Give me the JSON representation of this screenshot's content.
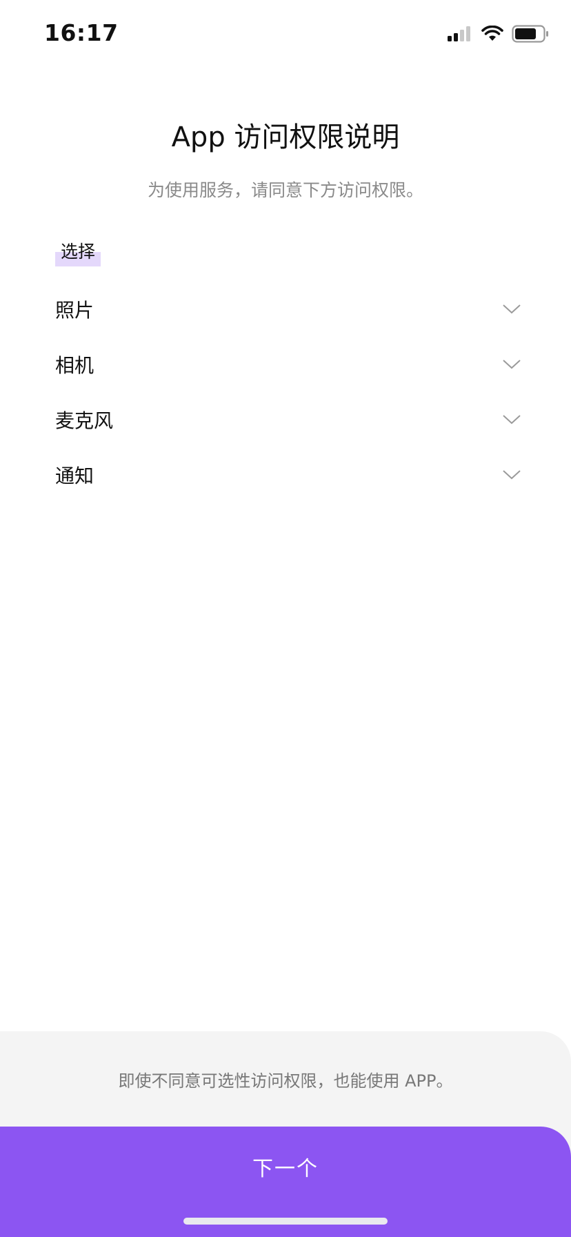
{
  "status_bar": {
    "time": "16:17",
    "icons": [
      "signal-icon",
      "wifi-icon",
      "battery-icon"
    ]
  },
  "header": {
    "title": "App 访问权限说明",
    "subtitle": "为使用服务，请同意下方访问权限。"
  },
  "section": {
    "label": "选择"
  },
  "permissions": [
    {
      "label": "照片",
      "icon": "chevron-down-icon"
    },
    {
      "label": "相机",
      "icon": "chevron-down-icon"
    },
    {
      "label": "麦克风",
      "icon": "chevron-down-icon"
    },
    {
      "label": "通知",
      "icon": "chevron-down-icon"
    }
  ],
  "footer": {
    "note": "即使不同意可选性访问权限，也能使用 APP。",
    "next_label": "下一个"
  },
  "colors": {
    "accent": "#8c55f2",
    "label_highlight": "#e4d8fb",
    "sheet_background": "#f4f4f4",
    "subtitle_text": "#8a8a8a"
  }
}
